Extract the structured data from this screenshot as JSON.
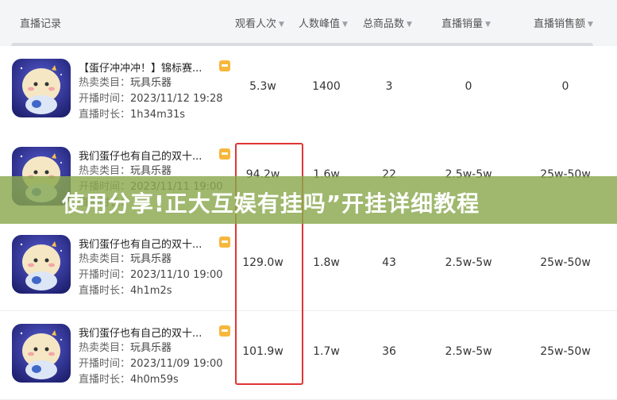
{
  "header": {
    "col_record": "直播记录",
    "col_views": "观看人次",
    "col_peak": "人数峰值",
    "col_products": "总商品数",
    "col_sales": "直播销量",
    "col_revenue": "直播销售额"
  },
  "labels": {
    "category": "热卖类目：",
    "start": "开播时间：",
    "duration": "直播时长："
  },
  "rows": [
    {
      "title": "【蛋仔冲冲冲！】锦标赛...",
      "category": "玩具乐器",
      "start": "2023/11/12 19:28",
      "duration": "1h34m31s",
      "views": "5.3w",
      "peak": "1400",
      "products": "3",
      "sales": "0",
      "revenue": "0"
    },
    {
      "title": "我们蛋仔也有自己的双十...",
      "category": "玩具乐器",
      "start": "2023/11/11 19:00",
      "duration": "",
      "views": "94.2w",
      "peak": "1.6w",
      "products": "22",
      "sales": "2.5w-5w",
      "revenue": "25w-50w"
    },
    {
      "title": "我们蛋仔也有自己的双十...",
      "category": "玩具乐器",
      "start": "2023/11/10 19:00",
      "duration": "4h1m2s",
      "views": "129.0w",
      "peak": "1.8w",
      "products": "43",
      "sales": "2.5w-5w",
      "revenue": "25w-50w"
    },
    {
      "title": "我们蛋仔也有自己的双十...",
      "category": "玩具乐器",
      "start": "2023/11/09 19:00",
      "duration": "4h0m59s",
      "views": "101.9w",
      "peak": "1.7w",
      "products": "36",
      "sales": "2.5w-5w",
      "revenue": "25w-50w"
    }
  ],
  "banner": {
    "text": "使用分享!正大互娱有挂吗”开挂详细教程"
  },
  "colors": {
    "header_bg": "#f4f5f7",
    "highlight": "#e03434",
    "banner": "#8aa84e",
    "tag": "#f6b73c"
  }
}
